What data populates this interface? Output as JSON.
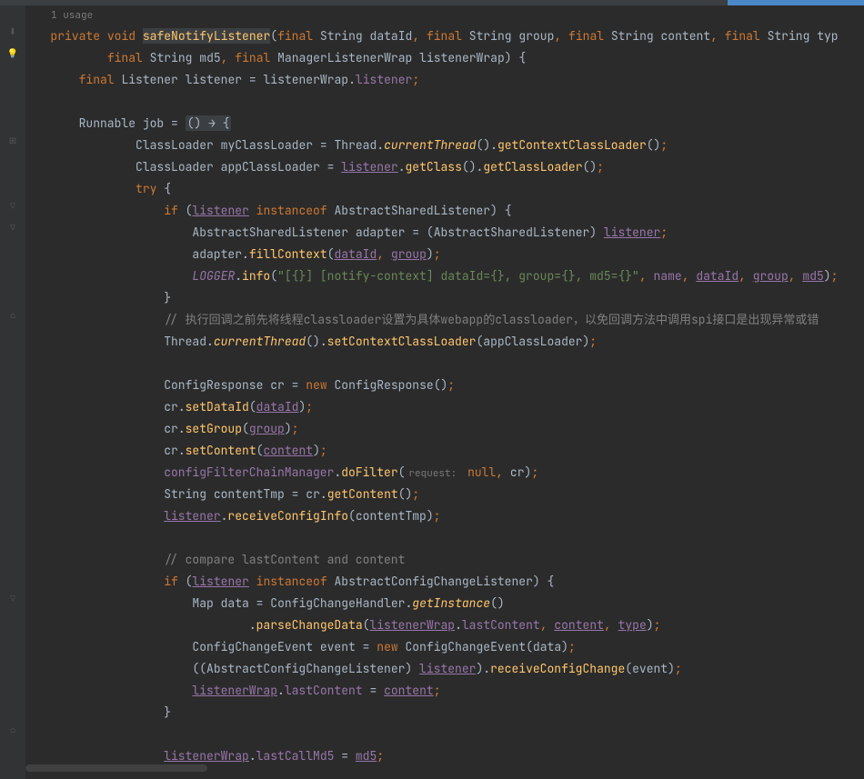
{
  "usage_hint": "1 usage",
  "code": {
    "l1": {
      "private": "private",
      "void": "void",
      "method": "safeNotifyListener",
      "p1_final": "final",
      "p1_type": "String",
      "p1_name": "dataId",
      "p2_final": "final",
      "p2_type": "String",
      "p2_name": "group",
      "p3_final": "final",
      "p3_type": "String",
      "p3_name": "content",
      "p4_final": "final",
      "p4_type": "String",
      "p4_name": "typ"
    },
    "l2": {
      "p5_final": "final",
      "p5_type": "String",
      "p5_name": "md5",
      "p6_final": "final",
      "p6_type": "ManagerListenerWrap",
      "p6_name": "listenerWrap",
      "brace": "{"
    },
    "l3": {
      "final": "final",
      "type": "Listener",
      "var": "listener",
      "eq": "=",
      "src": "listenerWrap",
      "dot": ".",
      "field": "listener",
      "semi": ";"
    },
    "l5": {
      "type": "Runnable",
      "var": "job",
      "eq": "=",
      "lambda": "() → {"
    },
    "l6": {
      "type": "ClassLoader",
      "var": "myClassLoader",
      "eq": "=",
      "thread": "Thread",
      "dot": ".",
      "currentThread": "currentThread",
      "getCCL": "getContextClassLoader"
    },
    "l7": {
      "type": "ClassLoader",
      "var": "appClassLoader",
      "eq": "=",
      "listener": "listener",
      "getClass": "getClass",
      "getCL": "getClassLoader"
    },
    "l8": {
      "try": "try",
      "brace": "{"
    },
    "l9": {
      "if": "if",
      "listener": "listener",
      "instanceof": "instanceof",
      "type": "AbstractSharedListener",
      "brace": "{"
    },
    "l10": {
      "type": "AbstractSharedListener",
      "var": "adapter",
      "eq": "=",
      "cast": "AbstractSharedListener",
      "listener": "listener"
    },
    "l11": {
      "var": "adapter",
      "method": "fillContext",
      "dataId": "dataId",
      "group": "group"
    },
    "l12": {
      "logger": "LOGGER",
      "info": "info",
      "str": "\"[{}] [notify-context] dataId={}, group={}, md5={}\"",
      "name": "name",
      "dataId": "dataId",
      "group": "group",
      "md5": "md5"
    },
    "l13": {
      "brace": "}"
    },
    "l14": {
      "comment": "// 执行回调之前先将线程classloader设置为具体webapp的classloader，以免回调方法中调用spi接口是出现异常或错"
    },
    "l15": {
      "thread": "Thread",
      "currentThread": "currentThread",
      "setCCL": "setContextClassLoader",
      "arg": "appClassLoader"
    },
    "l17": {
      "type": "ConfigResponse",
      "var": "cr",
      "eq": "=",
      "new": "new",
      "ctor": "ConfigResponse"
    },
    "l18": {
      "var": "cr",
      "method": "setDataId",
      "arg": "dataId"
    },
    "l19": {
      "var": "cr",
      "method": "setGroup",
      "arg": "group"
    },
    "l20": {
      "var": "cr",
      "method": "setContent",
      "arg": "content"
    },
    "l21": {
      "var": "configFilterChainManager",
      "method": "doFilter",
      "hint": "request:",
      "null": "null",
      "cr": "cr"
    },
    "l22": {
      "type": "String",
      "var": "contentTmp",
      "eq": "=",
      "cr": "cr",
      "method": "getContent"
    },
    "l23": {
      "var": "listener",
      "method": "receiveConfigInfo",
      "arg": "contentTmp"
    },
    "l25": {
      "comment": "// compare lastContent and content"
    },
    "l26": {
      "if": "if",
      "listener": "listener",
      "instanceof": "instanceof",
      "type": "AbstractConfigChangeListener",
      "brace": "{"
    },
    "l27": {
      "type": "Map",
      "var": "data",
      "eq": "=",
      "handler": "ConfigChangeHandler",
      "getInstance": "getInstance"
    },
    "l28": {
      "method": "parseChangeData",
      "listenerWrap": "listenerWrap",
      "lastContent": "lastContent",
      "content": "content",
      "type": "type"
    },
    "l29": {
      "type": "ConfigChangeEvent",
      "var": "event",
      "eq": "=",
      "new": "new",
      "ctor": "ConfigChangeEvent",
      "arg": "data"
    },
    "l30": {
      "cast": "AbstractConfigChangeListener",
      "listener": "listener",
      "method": "receiveConfigChange",
      "arg": "event"
    },
    "l31": {
      "listenerWrap": "listenerWrap",
      "lastContent": "lastContent",
      "eq": "=",
      "content": "content"
    },
    "l32": {
      "brace": "}"
    },
    "l34": {
      "listenerWrap": "listenerWrap",
      "lastCallMd5": "lastCallMd5",
      "eq": "=",
      "md5": "md5"
    }
  }
}
